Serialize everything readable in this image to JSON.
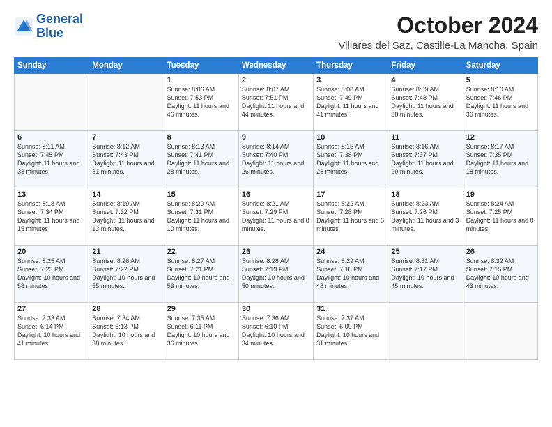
{
  "logo": {
    "line1": "General",
    "line2": "Blue"
  },
  "title": "October 2024",
  "location": "Villares del Saz, Castille-La Mancha, Spain",
  "days_of_week": [
    "Sunday",
    "Monday",
    "Tuesday",
    "Wednesday",
    "Thursday",
    "Friday",
    "Saturday"
  ],
  "weeks": [
    [
      {
        "day": "",
        "info": ""
      },
      {
        "day": "",
        "info": ""
      },
      {
        "day": "1",
        "info": "Sunrise: 8:06 AM\nSunset: 7:53 PM\nDaylight: 11 hours and 46 minutes."
      },
      {
        "day": "2",
        "info": "Sunrise: 8:07 AM\nSunset: 7:51 PM\nDaylight: 11 hours and 44 minutes."
      },
      {
        "day": "3",
        "info": "Sunrise: 8:08 AM\nSunset: 7:49 PM\nDaylight: 11 hours and 41 minutes."
      },
      {
        "day": "4",
        "info": "Sunrise: 8:09 AM\nSunset: 7:48 PM\nDaylight: 11 hours and 38 minutes."
      },
      {
        "day": "5",
        "info": "Sunrise: 8:10 AM\nSunset: 7:46 PM\nDaylight: 11 hours and 36 minutes."
      }
    ],
    [
      {
        "day": "6",
        "info": "Sunrise: 8:11 AM\nSunset: 7:45 PM\nDaylight: 11 hours and 33 minutes."
      },
      {
        "day": "7",
        "info": "Sunrise: 8:12 AM\nSunset: 7:43 PM\nDaylight: 11 hours and 31 minutes."
      },
      {
        "day": "8",
        "info": "Sunrise: 8:13 AM\nSunset: 7:41 PM\nDaylight: 11 hours and 28 minutes."
      },
      {
        "day": "9",
        "info": "Sunrise: 8:14 AM\nSunset: 7:40 PM\nDaylight: 11 hours and 26 minutes."
      },
      {
        "day": "10",
        "info": "Sunrise: 8:15 AM\nSunset: 7:38 PM\nDaylight: 11 hours and 23 minutes."
      },
      {
        "day": "11",
        "info": "Sunrise: 8:16 AM\nSunset: 7:37 PM\nDaylight: 11 hours and 20 minutes."
      },
      {
        "day": "12",
        "info": "Sunrise: 8:17 AM\nSunset: 7:35 PM\nDaylight: 11 hours and 18 minutes."
      }
    ],
    [
      {
        "day": "13",
        "info": "Sunrise: 8:18 AM\nSunset: 7:34 PM\nDaylight: 11 hours and 15 minutes."
      },
      {
        "day": "14",
        "info": "Sunrise: 8:19 AM\nSunset: 7:32 PM\nDaylight: 11 hours and 13 minutes."
      },
      {
        "day": "15",
        "info": "Sunrise: 8:20 AM\nSunset: 7:31 PM\nDaylight: 11 hours and 10 minutes."
      },
      {
        "day": "16",
        "info": "Sunrise: 8:21 AM\nSunset: 7:29 PM\nDaylight: 11 hours and 8 minutes."
      },
      {
        "day": "17",
        "info": "Sunrise: 8:22 AM\nSunset: 7:28 PM\nDaylight: 11 hours and 5 minutes."
      },
      {
        "day": "18",
        "info": "Sunrise: 8:23 AM\nSunset: 7:26 PM\nDaylight: 11 hours and 3 minutes."
      },
      {
        "day": "19",
        "info": "Sunrise: 8:24 AM\nSunset: 7:25 PM\nDaylight: 11 hours and 0 minutes."
      }
    ],
    [
      {
        "day": "20",
        "info": "Sunrise: 8:25 AM\nSunset: 7:23 PM\nDaylight: 10 hours and 58 minutes."
      },
      {
        "day": "21",
        "info": "Sunrise: 8:26 AM\nSunset: 7:22 PM\nDaylight: 10 hours and 55 minutes."
      },
      {
        "day": "22",
        "info": "Sunrise: 8:27 AM\nSunset: 7:21 PM\nDaylight: 10 hours and 53 minutes."
      },
      {
        "day": "23",
        "info": "Sunrise: 8:28 AM\nSunset: 7:19 PM\nDaylight: 10 hours and 50 minutes."
      },
      {
        "day": "24",
        "info": "Sunrise: 8:29 AM\nSunset: 7:18 PM\nDaylight: 10 hours and 48 minutes."
      },
      {
        "day": "25",
        "info": "Sunrise: 8:31 AM\nSunset: 7:17 PM\nDaylight: 10 hours and 45 minutes."
      },
      {
        "day": "26",
        "info": "Sunrise: 8:32 AM\nSunset: 7:15 PM\nDaylight: 10 hours and 43 minutes."
      }
    ],
    [
      {
        "day": "27",
        "info": "Sunrise: 7:33 AM\nSunset: 6:14 PM\nDaylight: 10 hours and 41 minutes."
      },
      {
        "day": "28",
        "info": "Sunrise: 7:34 AM\nSunset: 6:13 PM\nDaylight: 10 hours and 38 minutes."
      },
      {
        "day": "29",
        "info": "Sunrise: 7:35 AM\nSunset: 6:11 PM\nDaylight: 10 hours and 36 minutes."
      },
      {
        "day": "30",
        "info": "Sunrise: 7:36 AM\nSunset: 6:10 PM\nDaylight: 10 hours and 34 minutes."
      },
      {
        "day": "31",
        "info": "Sunrise: 7:37 AM\nSunset: 6:09 PM\nDaylight: 10 hours and 31 minutes."
      },
      {
        "day": "",
        "info": ""
      },
      {
        "day": "",
        "info": ""
      }
    ]
  ]
}
